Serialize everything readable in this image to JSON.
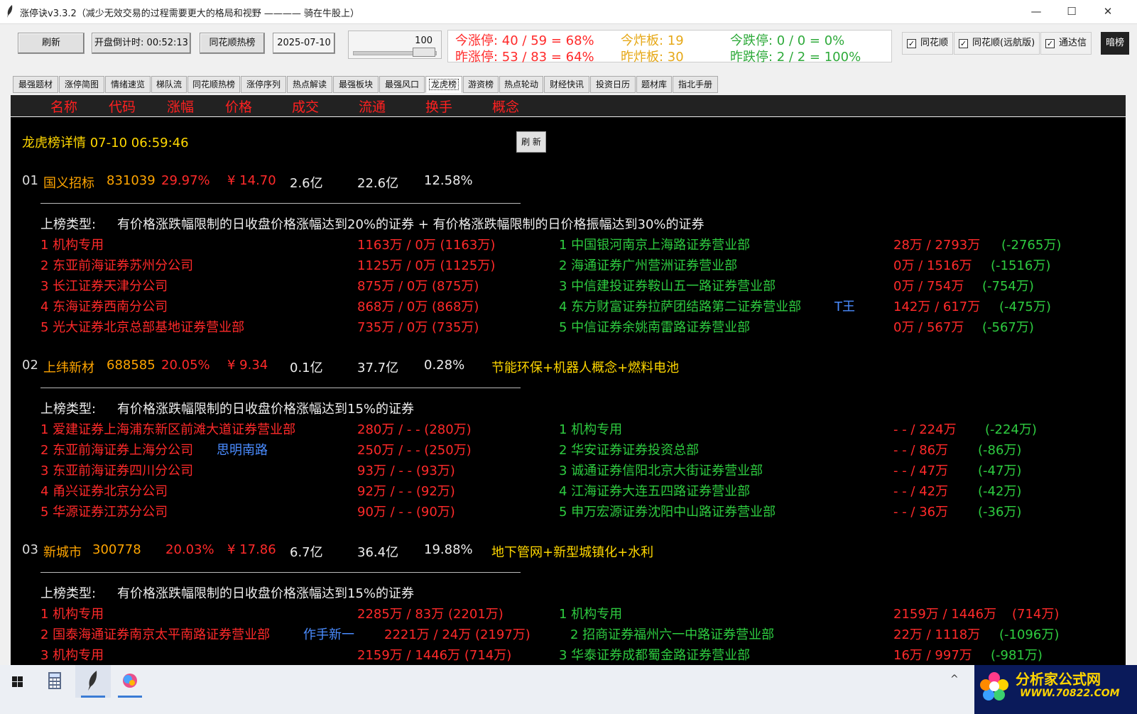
{
  "window": {
    "title": "涨停诀v3.3.2（减少无效交易的过程需要更大的格局和视野 ———— 骑在牛股上）",
    "controls": {
      "minimize": "—",
      "maximize": "☐",
      "close": "✕"
    }
  },
  "toolbar": {
    "refresh_label": "刷新",
    "countdown_label": "开盘倒计时: 00:52:13",
    "hot_label": "同花顺热榜",
    "date_value": "2025-07-10",
    "slider_value": "100",
    "dark_label": "暗榜"
  },
  "stats": {
    "today_limit_up": "今涨停: 40 / 59 = 68%",
    "yesterday_limit_up": "昨涨停: 53 / 83 = 64%",
    "today_broken": "今炸板: 19",
    "yesterday_broken": "昨炸板: 30",
    "today_limit_down": "今跌停: 0 / 0 = 0%",
    "yesterday_limit_down": "昨跌停: 2 / 2 = 100%"
  },
  "checkboxes": [
    {
      "label": "同花顺",
      "checked": true
    },
    {
      "label": "同花顺(远航版)",
      "checked": true
    },
    {
      "label": "通达信",
      "checked": true
    }
  ],
  "tabs": [
    "最强题材",
    "涨停简图",
    "情绪速览",
    "梯队流",
    "同花顺热榜",
    "涨停序列",
    "热点解读",
    "最强板块",
    "最强风口",
    "龙虎榜",
    "游资榜",
    "热点轮动",
    "财经快讯",
    "投资日历",
    "题材库",
    "指北手册"
  ],
  "active_tab": "龙虎榜",
  "columns": [
    "名称",
    "代码",
    "涨幅",
    "价格",
    "成交",
    "流通",
    "换手",
    "概念"
  ],
  "detail": {
    "header": "龙虎榜详情 07-10 06:59:46",
    "refresh_label": "刷 新",
    "type_prefix": "上榜类型:",
    "stocks": [
      {
        "idx": "01",
        "name": "国义招标",
        "code": "831039",
        "pct": "29.97%",
        "price": "¥ 14.70",
        "amount": "2.6亿",
        "float": "22.6亿",
        "turnover": "12.58%",
        "concept": "",
        "type": "有价格涨跌幅限制的日收盘价格涨幅达到20%的证券 + 有价格涨跌幅限制的日价格振幅达到30%的证券",
        "buys": [
          {
            "name": "1 机构专用",
            "tag": "",
            "val": "1163万 / 0万  (1163万)"
          },
          {
            "name": "2 东亚前海证券苏州分公司",
            "tag": "",
            "val": "1125万 / 0万  (1125万)"
          },
          {
            "name": "3 长江证券天津分公司",
            "tag": "",
            "val": "875万 / 0万  (875万)"
          },
          {
            "name": "4 东海证券西南分公司",
            "tag": "",
            "val": "868万 / 0万  (868万)"
          },
          {
            "name": "5 光大证券北京总部基地证券营业部",
            "tag": "",
            "val": "735万 / 0万  (735万)"
          }
        ],
        "sells": [
          {
            "name": "1 中国银河南京上海路证券营业部",
            "tag": "",
            "vr": "28万 / 2793万",
            "vg": "(-2765万)"
          },
          {
            "name": "2 海通证券广州营洲证券营业部",
            "tag": "",
            "vr": "0万 / 1516万",
            "vg": "(-1516万)"
          },
          {
            "name": "3 中信建投证券鞍山五一路证券营业部",
            "tag": "",
            "vr": "0万 / 754万",
            "vg": "(-754万)"
          },
          {
            "name": "4 东方财富证券拉萨团结路第二证券营业部",
            "tag": "T王",
            "vr": "142万 / 617万",
            "vg": "(-475万)"
          },
          {
            "name": "5 中信证券余姚南雷路证券营业部",
            "tag": "",
            "vr": "0万 / 567万",
            "vg": "(-567万)"
          }
        ]
      },
      {
        "idx": "02",
        "name": "上纬新材",
        "code": "688585",
        "pct": "20.05%",
        "price": "¥ 9.34",
        "amount": "0.1亿",
        "float": "37.7亿",
        "turnover": "0.28%",
        "concept": "节能环保+机器人概念+燃料电池",
        "type": "有价格涨跌幅限制的日收盘价格涨幅达到15%的证券",
        "buys": [
          {
            "name": "1 爱建证券上海浦东新区前滩大道证券营业部",
            "tag": "",
            "val": "280万 / -    -  (280万)"
          },
          {
            "name": "2 东亚前海证券上海分公司",
            "tag": "思明南路",
            "val": "250万 / -    -  (250万)"
          },
          {
            "name": "3 东亚前海证券四川分公司",
            "tag": "",
            "val": "93万 / -    -  (93万)"
          },
          {
            "name": "4 甬兴证券北京分公司",
            "tag": "",
            "val": "92万 / -    -  (92万)"
          },
          {
            "name": "5 华源证券江苏分公司",
            "tag": "",
            "val": "90万 / -    -  (90万)"
          }
        ],
        "sells": [
          {
            "name": "1 机构专用",
            "tag": "",
            "vr": "-    - / 224万",
            "vg": "(-224万)"
          },
          {
            "name": "2 华安证券证券投资总部",
            "tag": "",
            "vr": "-    - / 86万",
            "vg": "(-86万)"
          },
          {
            "name": "3 诚通证券信阳北京大街证券营业部",
            "tag": "",
            "vr": "-    - / 47万",
            "vg": "(-47万)"
          },
          {
            "name": "4 江海证券大连五四路证券营业部",
            "tag": "",
            "vr": "-    - / 42万",
            "vg": "(-42万)"
          },
          {
            "name": "5 申万宏源证券沈阳中山路证券营业部",
            "tag": "",
            "vr": "-    - / 36万",
            "vg": "(-36万)"
          }
        ]
      },
      {
        "idx": "03",
        "name": "新城市",
        "code": "300778",
        "pct": "20.03%",
        "price": "¥ 17.86",
        "amount": "6.7亿",
        "float": "36.4亿",
        "turnover": "19.88%",
        "concept": "地下管网+新型城镇化+水利",
        "type": "有价格涨跌幅限制的日收盘价格涨幅达到15%的证券",
        "buys": [
          {
            "name": "1 机构专用",
            "tag": "",
            "val": "2285万 / 83万  (2201万)"
          },
          {
            "name": "2 国泰海通证券南京太平南路证券营业部",
            "tag": "作手新一",
            "val": "2221万 / 24万  (2197万)"
          },
          {
            "name": "3 机构专用",
            "tag": "",
            "val": "2159万 / 1446万  (714万)"
          }
        ],
        "sells": [
          {
            "name": "1 机构专用",
            "tag": "",
            "vr": "2159万 / 1446万",
            "vg": "(714万)"
          },
          {
            "name": "2 招商证券福州六一中路证券营业部",
            "tag": "",
            "vr": "22万 / 1118万",
            "vg": "(-1096万)"
          },
          {
            "name": "3 华泰证券成都蜀金路证券营业部",
            "tag": "",
            "vr": "16万 / 997万",
            "vg": "(-981万)"
          }
        ]
      }
    ]
  },
  "taskbar": {
    "items": [
      "windows-start-icon",
      "calculator-icon",
      "feather-app-icon",
      "color-app-icon"
    ],
    "tray": "^",
    "brand_name": "分析家公式网",
    "brand_url": "WWW.70822.COM"
  }
}
